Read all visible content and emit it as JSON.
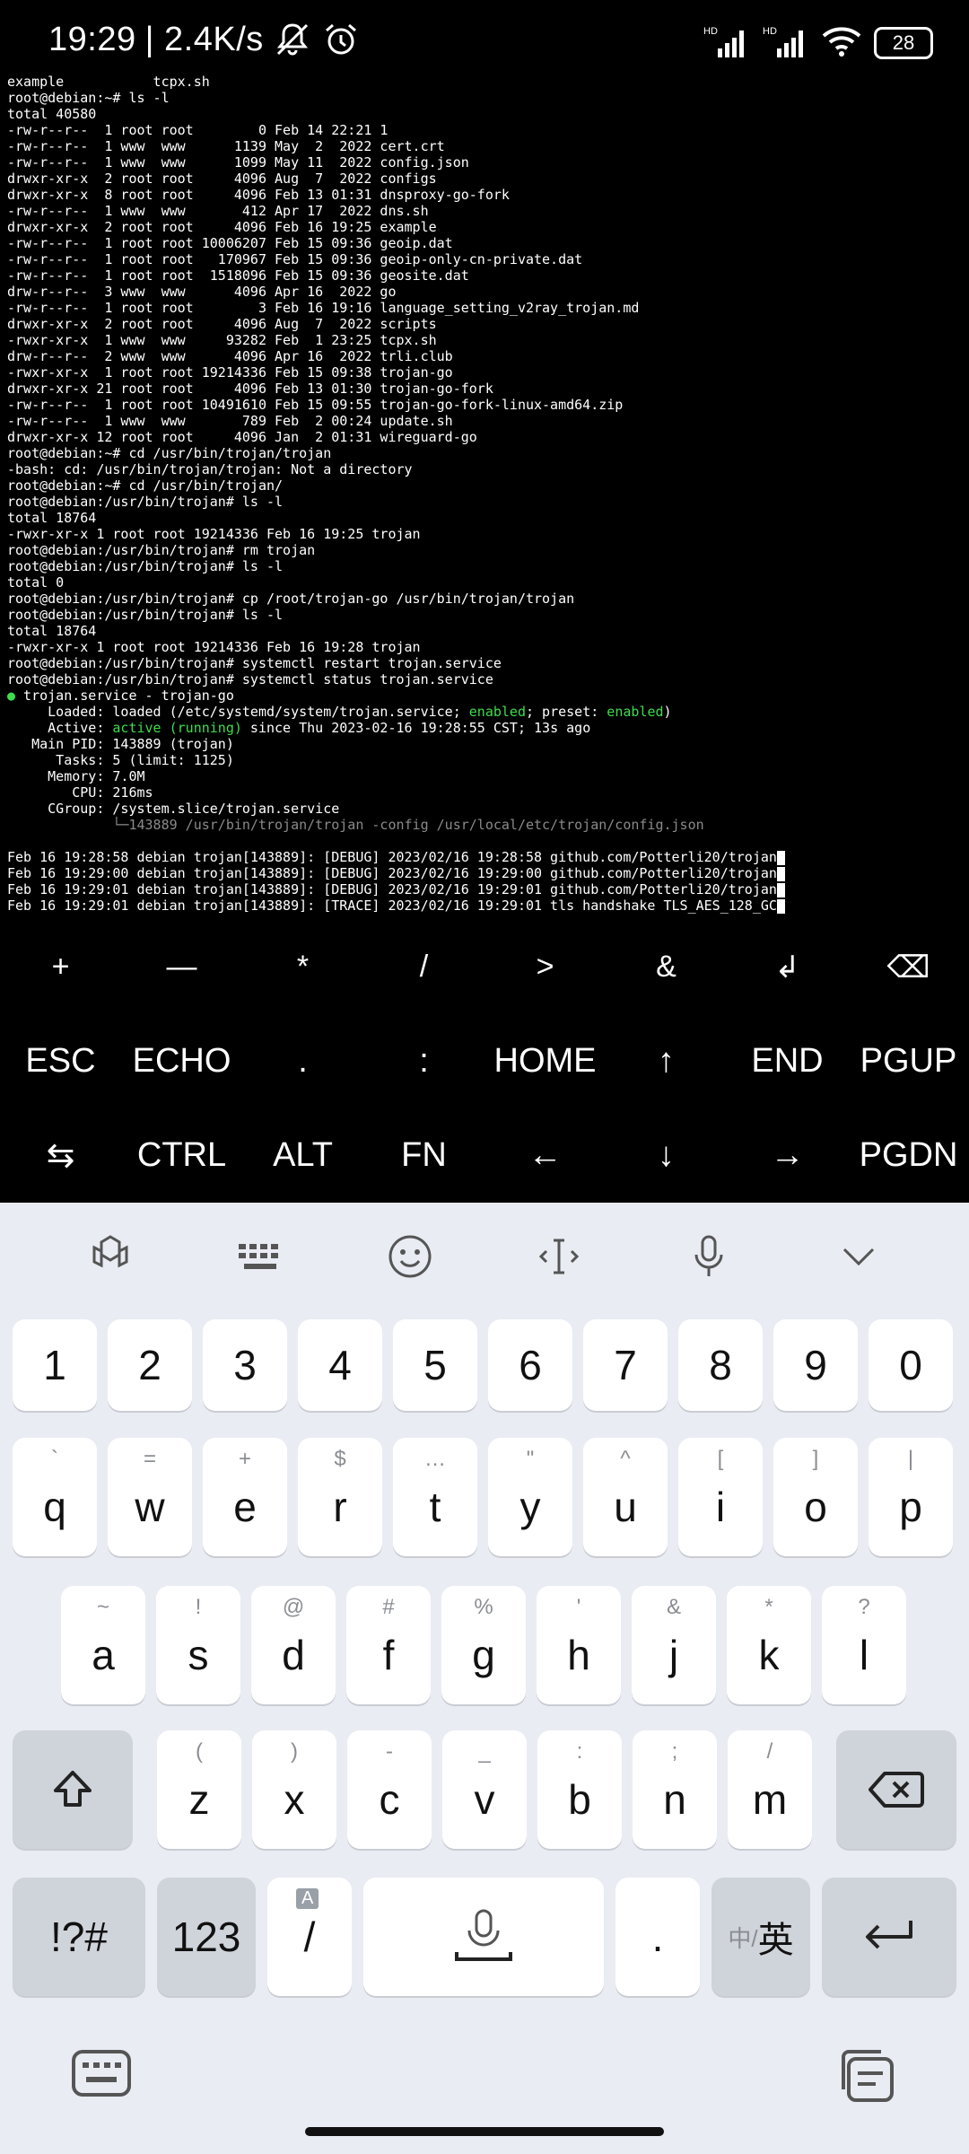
{
  "status_bar": {
    "time": "19:29",
    "speed": "| 2.4K/s",
    "battery": "28"
  },
  "terminal": {
    "lines": [
      "example           tcpx.sh",
      "root@debian:~# ls -l",
      "total 40580",
      "-rw-r--r--  1 root root        0 Feb 14 22:21 1",
      "-rw-r--r--  1 www  www      1139 May  2  2022 cert.crt",
      "-rw-r--r--  1 www  www      1099 May 11  2022 config.json",
      "drwxr-xr-x  2 root root     4096 Aug  7  2022 configs",
      "drwxr-xr-x  8 root root     4096 Feb 13 01:31 dnsproxy-go-fork",
      "-rw-r--r--  1 www  www       412 Apr 17  2022 dns.sh",
      "drwxr-xr-x  2 root root     4096 Feb 16 19:25 example",
      "-rw-r--r--  1 root root 10006207 Feb 15 09:36 geoip.dat",
      "-rw-r--r--  1 root root   170967 Feb 15 09:36 geoip-only-cn-private.dat",
      "-rw-r--r--  1 root root  1518096 Feb 15 09:36 geosite.dat",
      "drw-r--r--  3 www  www      4096 Apr 16  2022 go",
      "-rw-r--r--  1 root root        3 Feb 16 19:16 language_setting_v2ray_trojan.md",
      "drwxr-xr-x  2 root root     4096 Aug  7  2022 scripts",
      "-rwxr-xr-x  1 www  www     93282 Feb  1 23:25 tcpx.sh",
      "drw-r--r--  2 www  www      4096 Apr 16  2022 trli.club",
      "-rwxr-xr-x  1 root root 19214336 Feb 15 09:38 trojan-go",
      "drwxr-xr-x 21 root root     4096 Feb 13 01:30 trojan-go-fork",
      "-rw-r--r--  1 root root 10491610 Feb 15 09:55 trojan-go-fork-linux-amd64.zip",
      "-rw-r--r--  1 www  www       789 Feb  2 00:24 update.sh",
      "drwxr-xr-x 12 root root     4096 Jan  2 01:31 wireguard-go",
      "root@debian:~# cd /usr/bin/trojan/trojan",
      "-bash: cd: /usr/bin/trojan/trojan: Not a directory",
      "root@debian:~# cd /usr/bin/trojan/",
      "root@debian:/usr/bin/trojan# ls -l",
      "total 18764",
      "-rwxr-xr-x 1 root root 19214336 Feb 16 19:25 trojan",
      "root@debian:/usr/bin/trojan# rm trojan",
      "root@debian:/usr/bin/trojan# ls -l",
      "total 0",
      "root@debian:/usr/bin/trojan# cp /root/trojan-go /usr/bin/trojan/trojan",
      "root@debian:/usr/bin/trojan# ls -l",
      "total 18764",
      "-rwxr-xr-x 1 root root 19214336 Feb 16 19:28 trojan",
      "root@debian:/usr/bin/trojan# systemctl restart trojan.service",
      "root@debian:/usr/bin/trojan# systemctl status trojan.service"
    ],
    "service": {
      "dot": "●",
      "title": " trojan.service - trojan-go",
      "loaded_prefix": "     Loaded: loaded (/etc/systemd/system/trojan.service; ",
      "loaded_enabled": "enabled",
      "loaded_mid": "; preset: ",
      "loaded_preset": "enabled",
      "loaded_suffix": ")",
      "active_prefix": "     Active: ",
      "active_status": "active (running)",
      "active_suffix": " since Thu 2023-02-16 19:28:55 CST; 13s ago",
      "main_pid": "   Main PID: 143889 (trojan)",
      "tasks": "      Tasks: 5 (limit: 1125)",
      "memory": "     Memory: 7.0M",
      "cpu": "        CPU: 216ms",
      "cgroup": "     CGroup: /system.slice/trojan.service",
      "cgroup_child": "             └─143889 /usr/bin/trojan/trojan -config /usr/local/etc/trojan/config.json"
    },
    "logs": [
      "Feb 16 19:28:58 debian trojan[143889]: [DEBUG] 2023/02/16 19:28:58 github.com/Potterli20/trojan",
      "Feb 16 19:29:00 debian trojan[143889]: [DEBUG] 2023/02/16 19:29:00 github.com/Potterli20/trojan",
      "Feb 16 19:29:01 debian trojan[143889]: [DEBUG] 2023/02/16 19:29:01 github.com/Potterli20/trojan",
      "Feb 16 19:29:01 debian trojan[143889]: [TRACE] 2023/02/16 19:29:01 tls handshake TLS_AES_128_GC"
    ],
    "colors": {
      "green": "#3ddc4c",
      "gray": "#8a8a8a"
    }
  },
  "extra_keys": {
    "row1": [
      "+",
      "—",
      "*",
      "/",
      ">",
      "&",
      "↲",
      "⌫"
    ],
    "row2": [
      "ESC",
      "ECHO",
      ".",
      ":",
      "HOME",
      "↑",
      "END",
      "PGUP"
    ],
    "row3": [
      "⇆",
      "CTRL",
      "ALT",
      "FN",
      "←",
      "↓",
      "→",
      "PGDN"
    ]
  },
  "keyboard": {
    "toolbar_icons": [
      "theme-icon",
      "keyboard-grid-icon",
      "emoji-icon",
      "cursor-icon",
      "microphone-icon",
      "collapse-icon"
    ],
    "numbers": [
      "1",
      "2",
      "3",
      "4",
      "5",
      "6",
      "7",
      "8",
      "9",
      "0"
    ],
    "row_q": [
      {
        "k": "q",
        "s": "`"
      },
      {
        "k": "w",
        "s": "="
      },
      {
        "k": "e",
        "s": "+"
      },
      {
        "k": "r",
        "s": "$"
      },
      {
        "k": "t",
        "s": "…"
      },
      {
        "k": "y",
        "s": "\""
      },
      {
        "k": "u",
        "s": "^"
      },
      {
        "k": "i",
        "s": "["
      },
      {
        "k": "o",
        "s": "]"
      },
      {
        "k": "p",
        "s": "|"
      }
    ],
    "row_a": [
      {
        "k": "a",
        "s": "~"
      },
      {
        "k": "s",
        "s": "!"
      },
      {
        "k": "d",
        "s": "@"
      },
      {
        "k": "f",
        "s": "#"
      },
      {
        "k": "g",
        "s": "%"
      },
      {
        "k": "h",
        "s": "'"
      },
      {
        "k": "j",
        "s": "&"
      },
      {
        "k": "k",
        "s": "*"
      },
      {
        "k": "l",
        "s": "?"
      }
    ],
    "row_z": [
      {
        "k": "z",
        "s": "("
      },
      {
        "k": "x",
        "s": ")"
      },
      {
        "k": "c",
        "s": "-"
      },
      {
        "k": "v",
        "s": "_"
      },
      {
        "k": "b",
        "s": ":"
      },
      {
        "k": "n",
        "s": ";"
      },
      {
        "k": "m",
        "s": "/"
      }
    ],
    "bottom": {
      "symbols": "!?#",
      "numbers": "123",
      "slash": "/",
      "slash_badge": "A",
      "period": ".",
      "lang_cn": "中/",
      "lang_en": "英"
    }
  }
}
